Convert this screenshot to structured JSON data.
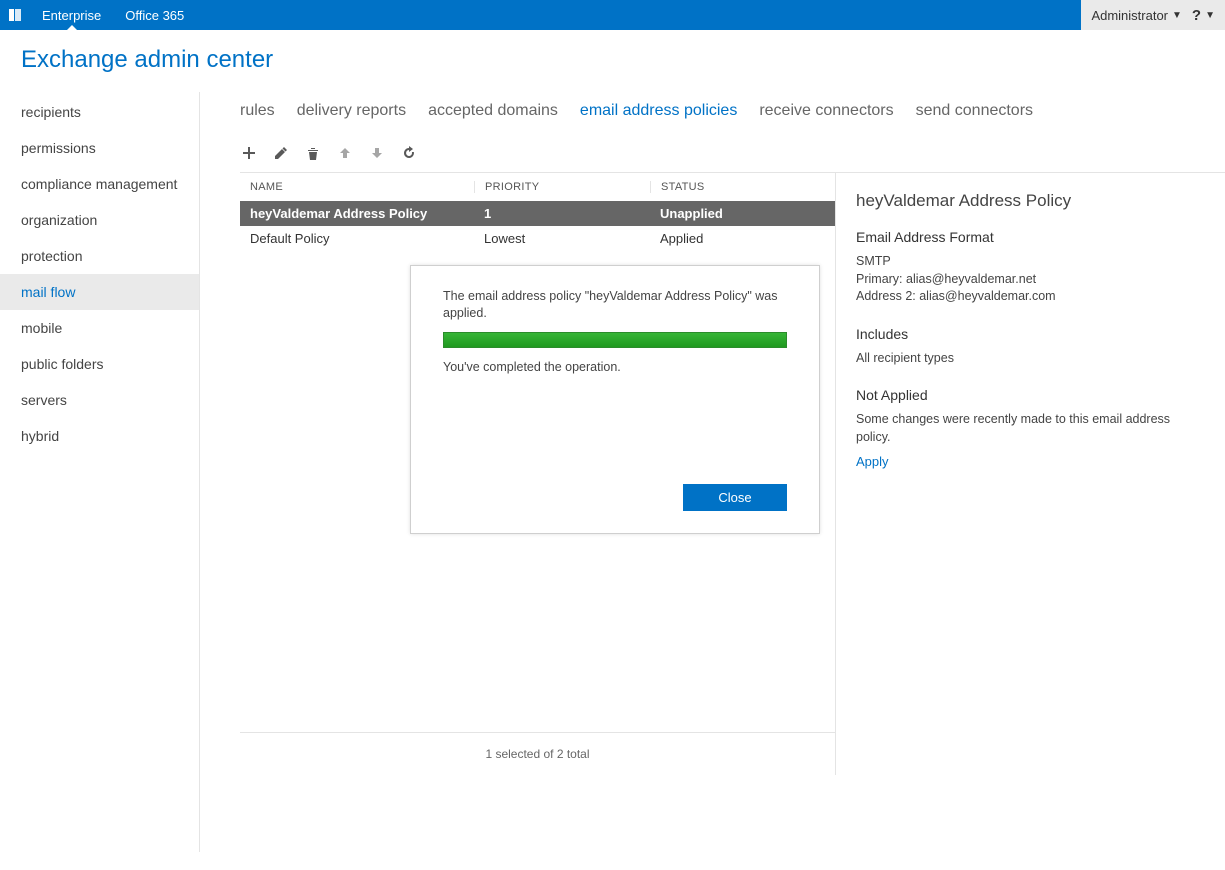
{
  "topbar": {
    "enterprise": "Enterprise",
    "office365": "Office 365",
    "user": "Administrator"
  },
  "page_title": "Exchange admin center",
  "sidebar": {
    "items": [
      {
        "label": "recipients"
      },
      {
        "label": "permissions"
      },
      {
        "label": "compliance management"
      },
      {
        "label": "organization"
      },
      {
        "label": "protection"
      },
      {
        "label": "mail flow"
      },
      {
        "label": "mobile"
      },
      {
        "label": "public folders"
      },
      {
        "label": "servers"
      },
      {
        "label": "hybrid"
      }
    ],
    "selected_index": 5
  },
  "subtabs": {
    "items": [
      {
        "label": "rules"
      },
      {
        "label": "delivery reports"
      },
      {
        "label": "accepted domains"
      },
      {
        "label": "email address policies"
      },
      {
        "label": "receive connectors"
      },
      {
        "label": "send connectors"
      }
    ],
    "active_index": 3
  },
  "toolbar": {
    "add": "add",
    "edit": "edit",
    "delete": "delete",
    "up": "move up",
    "down": "move down",
    "refresh": "refresh"
  },
  "grid": {
    "headers": {
      "name": "NAME",
      "priority": "PRIORITY",
      "status": "STATUS"
    },
    "rows": [
      {
        "name": "heyValdemar Address Policy",
        "priority": "1",
        "status": "Unapplied",
        "selected": true
      },
      {
        "name": "Default Policy",
        "priority": "Lowest",
        "status": "Applied",
        "selected": false
      }
    ],
    "status_line": "1 selected of 2 total"
  },
  "detail": {
    "title": "heyValdemar Address Policy",
    "format_header": "Email Address Format",
    "smtp_label": "SMTP",
    "primary": "Primary: alias@heyvaldemar.net",
    "address2": "Address 2: alias@heyvaldemar.com",
    "includes_header": "Includes",
    "includes_text": "All recipient types",
    "notapplied_header": "Not Applied",
    "notapplied_text": "Some changes were recently made to this email address policy.",
    "apply_link": "Apply"
  },
  "dialog": {
    "message": "The email address policy \"heyValdemar Address Policy\" was applied.",
    "completed": "You've completed the operation.",
    "close": "Close"
  }
}
